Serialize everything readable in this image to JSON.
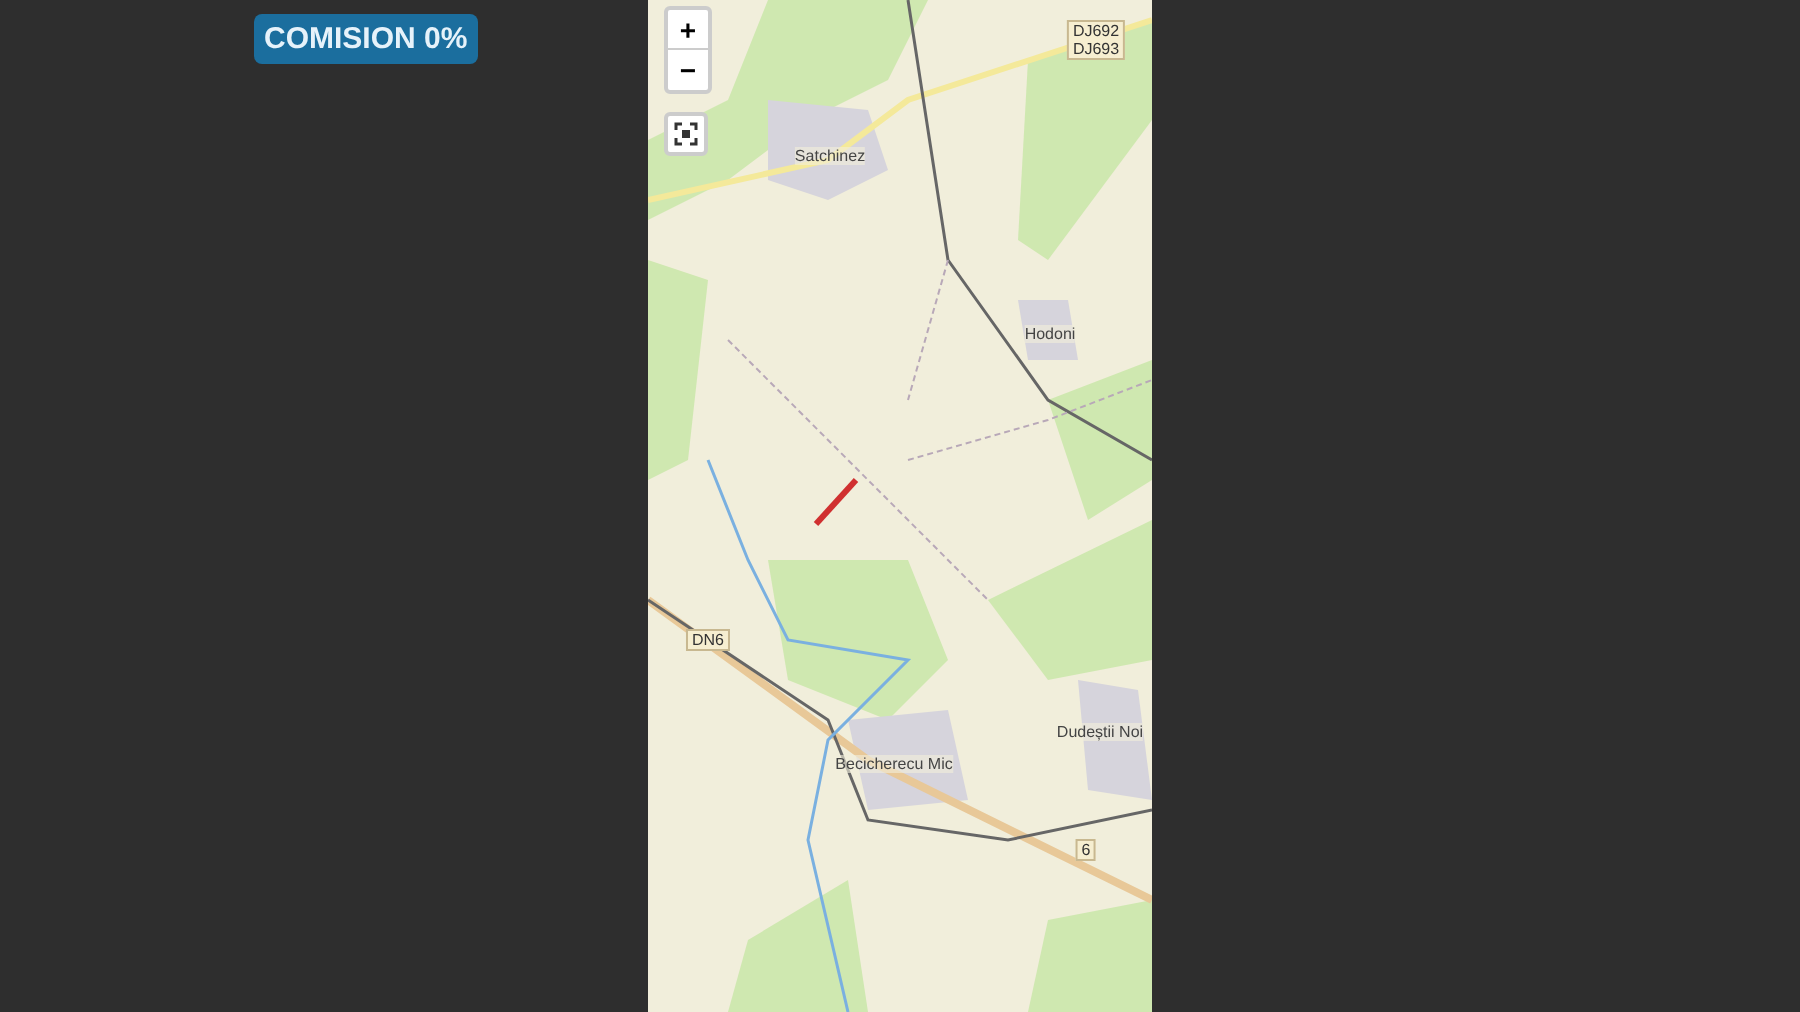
{
  "badge": "COMISION 0%",
  "map": {
    "zoom_in": "+",
    "zoom_out": "−",
    "labels": [
      {
        "kind": "shield",
        "text": "DJ692\nDJ693"
      },
      {
        "kind": "place",
        "text": "Satchinez"
      },
      {
        "kind": "place",
        "text": "Hodoni"
      },
      {
        "kind": "shield",
        "text": "DN6"
      },
      {
        "kind": "place",
        "text": "Dudeștii Noi"
      },
      {
        "kind": "place",
        "text": "Becicherecu Mic"
      },
      {
        "kind": "shield",
        "text": "6"
      }
    ]
  }
}
